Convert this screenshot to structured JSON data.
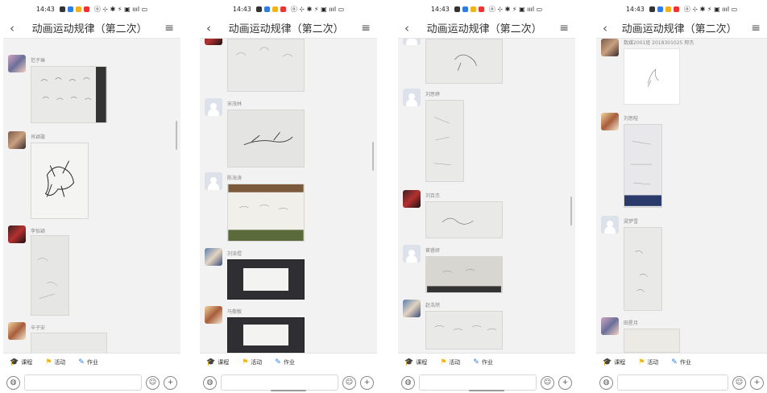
{
  "status_time": "14:43",
  "status_right": "ⓞ ⊹ ✱ ⚡ ▣ ıııl ▭",
  "screens": [
    {
      "title": "动画运动规律（第二次）",
      "messages": [
        {
          "name": "范子琳"
        },
        {
          "name": "肖颖璇"
        },
        {
          "name": "李怡颖"
        },
        {
          "name": "辛子安"
        }
      ]
    },
    {
      "title": "动画运动规律（第二次）",
      "messages": [
        {
          "name": ""
        },
        {
          "name": "宋茂林"
        },
        {
          "name": "陈海涛"
        },
        {
          "name": "刘泽煜"
        },
        {
          "name": "马敬敏"
        }
      ]
    },
    {
      "title": "动画运动规律（第二次）",
      "messages": [
        {
          "name": ""
        },
        {
          "name": "刘思婷"
        },
        {
          "name": "刘百杰"
        },
        {
          "name": "崔睿妍"
        },
        {
          "name": "赵浩然"
        }
      ]
    },
    {
      "title": "动画运动规律（第二次）",
      "messages": [
        {
          "name": "数媒2001班  2018301025 邢杰"
        },
        {
          "name": "刘思暄"
        },
        {
          "name": "梁梦雪"
        },
        {
          "name": "田星月"
        }
      ]
    }
  ],
  "tabs": {
    "course": "课程",
    "activity": "活动",
    "homework": "作业"
  },
  "icons": {
    "back": "chevron-left-icon",
    "menu": "menu-icon",
    "voice": "voice-icon",
    "emoji": "emoji-icon",
    "plus": "plus-icon"
  },
  "colors": {
    "course": "#16a0b0",
    "activity": "#f2b21a",
    "homework": "#2f7de1"
  }
}
